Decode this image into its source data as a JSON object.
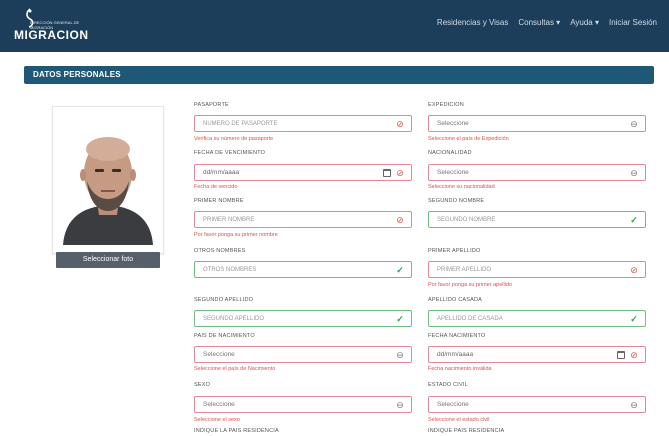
{
  "navbar": {
    "brand": "MIGRACION",
    "brand_small": "DIRECCIÓN GENERAL DE MIGRACIÓN",
    "links": [
      "Residencias y Visas",
      "Consultas ▾",
      "Ayuda ▾",
      "Iniciar Sesión"
    ]
  },
  "section": {
    "title": "DATOS PERSONALES"
  },
  "photo": {
    "button_label": "Seleccionar foto"
  },
  "form": {
    "pasaporte": {
      "label": "PASAPORTE",
      "placeholder": "NUMERO DE PASAPORTE",
      "error": "Verifica su número de pasaporte"
    },
    "expedicion": {
      "label": "EXPEDICION",
      "value": "Seleccione",
      "error": "Seleccione el país de Expedición"
    },
    "fecha_vencimiento": {
      "label": "FECHA DE VENCIMIENTO",
      "value": "dd/mm/aaaa",
      "error": "Fecha de vencido"
    },
    "nacionalidad": {
      "label": "NACIONALIDAD",
      "value": "Seleccione",
      "error": "Seleccione su nacionalidad"
    },
    "primer_nombre": {
      "label": "PRIMER NOMBRE",
      "placeholder": "PRIMER NOMBRE",
      "error": "Por favor ponga su primer nombre"
    },
    "segundo_nombre": {
      "label": "SEGUNDO NOMBRE",
      "placeholder": "SEGUNDO NOMBRE"
    },
    "otros_nombres": {
      "label": "OTROS NOMBRES",
      "placeholder": "OTROS NOMBRES"
    },
    "primer_apellido": {
      "label": "PRIMER APELLIDO",
      "placeholder": "PRIMER APELLIDO",
      "error": "Por favor ponga su primer apellido"
    },
    "segundo_apellido": {
      "label": "SEGUNDO APELLIDO",
      "placeholder": "SEGUNDO APELLIDO"
    },
    "apellido_casada": {
      "label": "APELLIDO CASADA",
      "placeholder": "APELLIDO DE CASADA"
    },
    "pais_nacimiento": {
      "label": "PAIS DE NACIMIENTO",
      "value": "Seleccione",
      "error": "Seleccione el país de Nacimiento"
    },
    "fecha_nacimiento": {
      "label": "FECHA NACIMIENTO",
      "value": "dd/mm/aaaa",
      "error": "Fecha nacimiento inválida"
    },
    "sexo": {
      "label": "SEXO",
      "value": "Seleccione",
      "error": "Seleccione el sexo"
    },
    "estado_civil": {
      "label": "ESTADO CIVIL",
      "value": "Seleccione",
      "error": "Seleccione el estado civil"
    },
    "footer_left": "INDIQUE LA PAIS RESIDENCIA",
    "footer_right": "INDIQUE PAIS RESIDENCIA"
  }
}
